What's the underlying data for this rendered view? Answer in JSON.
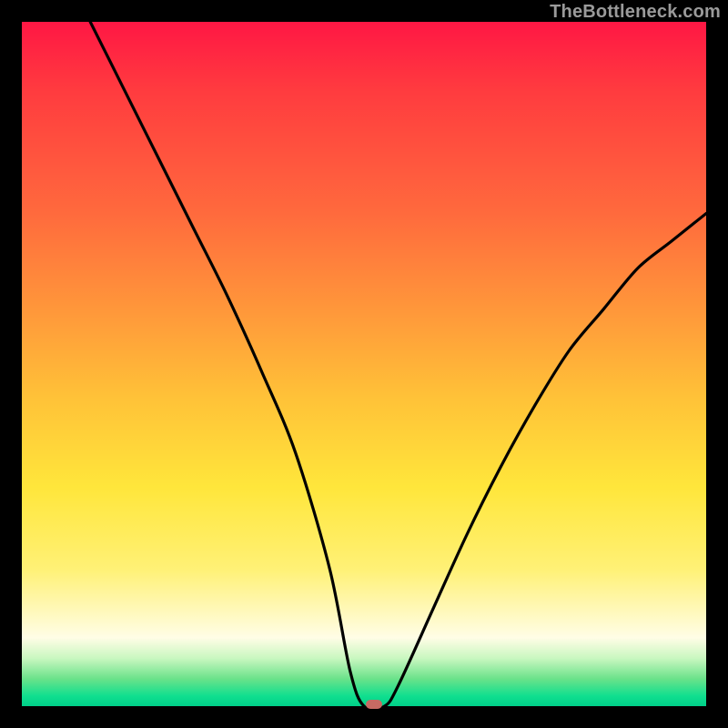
{
  "watermark": "TheBottleneck.com",
  "chart_data": {
    "type": "line",
    "title": "",
    "xlabel": "",
    "ylabel": "",
    "xlim": [
      0,
      100
    ],
    "ylim": [
      0,
      100
    ],
    "grid": false,
    "legend": false,
    "series": [
      {
        "name": "bottleneck-curve",
        "x": [
          10,
          15,
          20,
          25,
          30,
          35,
          40,
          45,
          48,
          50,
          53,
          55,
          60,
          65,
          70,
          75,
          80,
          85,
          90,
          95,
          100
        ],
        "y": [
          100,
          90,
          80,
          70,
          60,
          49,
          37,
          20,
          5,
          0,
          0,
          3,
          14,
          25,
          35,
          44,
          52,
          58,
          64,
          68,
          72
        ]
      }
    ],
    "marker": {
      "x": 51.5,
      "y": 0,
      "color": "#c66a63"
    },
    "background_gradient": {
      "stops": [
        {
          "pos": 0,
          "color": "#ff1744"
        },
        {
          "pos": 28,
          "color": "#ff6a3d"
        },
        {
          "pos": 55,
          "color": "#ffc238"
        },
        {
          "pos": 80,
          "color": "#fff176"
        },
        {
          "pos": 96,
          "color": "#6be28a"
        },
        {
          "pos": 100,
          "color": "#00d089"
        }
      ]
    }
  }
}
